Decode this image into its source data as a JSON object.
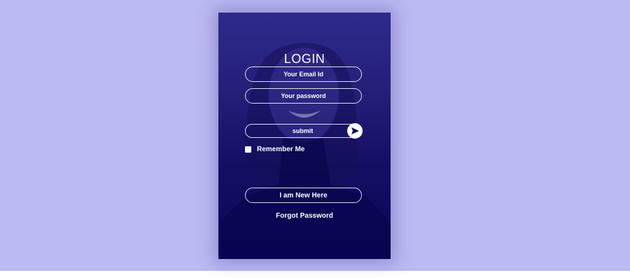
{
  "login": {
    "title": "LOGIN",
    "email_placeholder": "Your Email Id",
    "password_placeholder": "Your password",
    "submit_label": "submit",
    "submit_icon": "send-arrow-icon",
    "remember_label": "Remember Me",
    "new_here_label": "I am New Here",
    "forgot_label": "Forgot Password"
  },
  "colors": {
    "backdrop": "#bbbaf3",
    "card_overlay": "#0b0658",
    "text": "#ffffff"
  }
}
